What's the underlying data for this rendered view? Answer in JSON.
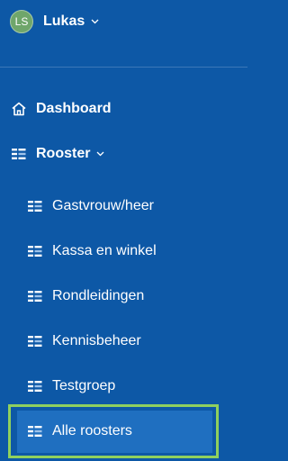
{
  "user": {
    "initials": "LS",
    "name": "Lukas"
  },
  "nav": {
    "dashboard_label": "Dashboard",
    "rooster_label": "Rooster",
    "rooster_items": [
      {
        "label": "Gastvrouw/heer"
      },
      {
        "label": "Kassa en winkel"
      },
      {
        "label": "Rondleidingen"
      },
      {
        "label": "Kennisbeheer"
      },
      {
        "label": "Testgroep"
      },
      {
        "label": "Alle roosters"
      }
    ],
    "selected_index": 5
  },
  "colors": {
    "sidebar_bg": "#0d58a6",
    "selected_bg": "#1f6fc0",
    "highlight_border": "#8fd05e",
    "avatar_bg": "#6fa66b"
  },
  "icons": {
    "home": "home-icon",
    "schedule": "schedule-icon",
    "chevron": "chevron-down-icon"
  }
}
